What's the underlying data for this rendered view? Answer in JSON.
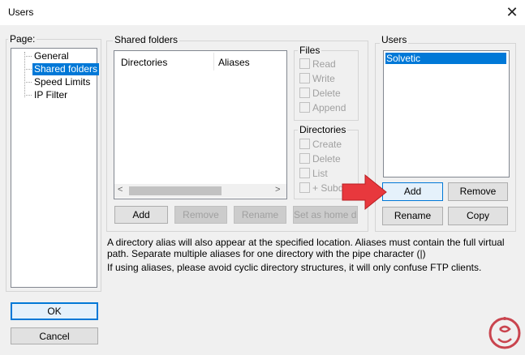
{
  "window": {
    "title": "Users",
    "close_glyph": "✕"
  },
  "page_group": {
    "label": "Page:",
    "items": [
      {
        "label": "General"
      },
      {
        "label": "Shared folders"
      },
      {
        "label": "Speed Limits"
      },
      {
        "label": "IP Filter"
      }
    ],
    "selected": "Shared folders"
  },
  "shared_folders": {
    "label": "Shared folders",
    "columns": [
      "Directories",
      "Aliases"
    ],
    "scroll_left": "<",
    "scroll_right": ">",
    "buttons": {
      "add": "Add",
      "remove": "Remove",
      "rename": "Rename",
      "set_home": "Set as home dir"
    },
    "files_group": {
      "label": "Files",
      "options": [
        "Read",
        "Write",
        "Delete",
        "Append"
      ]
    },
    "dirs_group": {
      "label": "Directories",
      "options": [
        "Create",
        "Delete",
        "List",
        "+ Subdirs"
      ]
    }
  },
  "users_group": {
    "label": "Users",
    "items": [
      "Solvetic"
    ],
    "selected": "Solvetic",
    "buttons": {
      "add": "Add",
      "remove": "Remove",
      "rename": "Rename",
      "copy": "Copy"
    }
  },
  "info": {
    "line1": "A directory alias will also appear at the specified location. Aliases must contain the full virtual",
    "line2": "path. Separate multiple aliases for one directory with the pipe character (|)",
    "line3": "If using aliases, please avoid cyclic directory structures, it will only confuse FTP clients."
  },
  "dialog_buttons": {
    "ok": "OK",
    "cancel": "Cancel"
  },
  "colors": {
    "selection": "#0078d7",
    "pointer_arrow": "#e8383d",
    "watermark": "#c9444e"
  }
}
